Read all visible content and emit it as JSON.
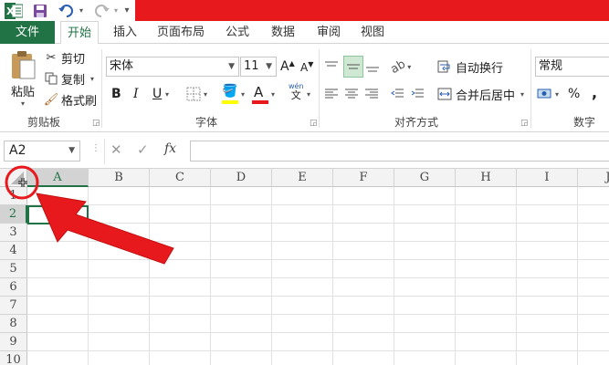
{
  "qat": {
    "app_icon": "excel-logo-icon",
    "save_icon": "save-icon",
    "undo_icon": "undo-icon",
    "redo_icon": "redo-icon",
    "title_bar_color": "#e8191d"
  },
  "tabs": [
    {
      "label": "文件"
    },
    {
      "label": "开始"
    },
    {
      "label": "插入"
    },
    {
      "label": "页面布局"
    },
    {
      "label": "公式"
    },
    {
      "label": "数据"
    },
    {
      "label": "审阅"
    },
    {
      "label": "视图"
    }
  ],
  "clipboard": {
    "paste_label": "粘贴",
    "cut_label": "剪切",
    "copy_label": "复制",
    "format_painter_label": "格式刷",
    "group_label": "剪贴板"
  },
  "font": {
    "font_name": "宋体",
    "font_size": "11",
    "bold": "B",
    "italic": "I",
    "underline": "U",
    "group_label": "字体",
    "wen": "文",
    "A_grow": "A",
    "A_shrink": "A"
  },
  "alignment": {
    "wrap_text_label": "自动换行",
    "merge_center_label": "合并后居中",
    "group_label": "对齐方式"
  },
  "number": {
    "format": "常规",
    "percent": "%",
    "comma": ",",
    "group_label": "数字"
  },
  "formula_bar": {
    "name_box": "A2",
    "fx": "fx",
    "cancel": "✕",
    "enter": "✓",
    "formula": ""
  },
  "grid": {
    "columns": [
      "A",
      "B",
      "C",
      "D",
      "E",
      "F",
      "G",
      "H",
      "I",
      "J"
    ],
    "rows": [
      "1",
      "2",
      "3",
      "4",
      "5",
      "6",
      "7",
      "8",
      "9",
      "10"
    ],
    "selected_cell": "A2"
  },
  "colors": {
    "accent": "#217346",
    "annotation": "#e8191d"
  }
}
